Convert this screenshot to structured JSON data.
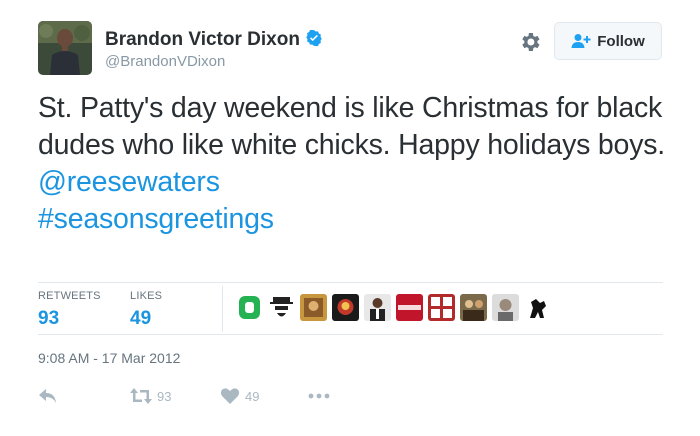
{
  "user": {
    "display_name": "Brandon Victor Dixon",
    "handle": "@BrandonVDixon",
    "verified": true
  },
  "follow_button": {
    "label": "Follow"
  },
  "tweet": {
    "text_line": "St. Patty's day weekend is like Christmas for black dudes who like white chicks. Happy holidays boys.",
    "mention": "@reesewaters",
    "hashtag": "#seasonsgreetings"
  },
  "stats": {
    "retweets_label": "RETWEETS",
    "retweets_count": "93",
    "likes_label": "LIKES",
    "likes_count": "49"
  },
  "timestamp": "9:08 AM - 17 Mar 2012",
  "actions": {
    "retweet_count": "93",
    "like_count": "49"
  },
  "colors": {
    "link": "#1b95e0",
    "verified": "#1da1f2",
    "text": "#292f33",
    "muted": "#66757f",
    "action_icon": "#aab8c2"
  }
}
